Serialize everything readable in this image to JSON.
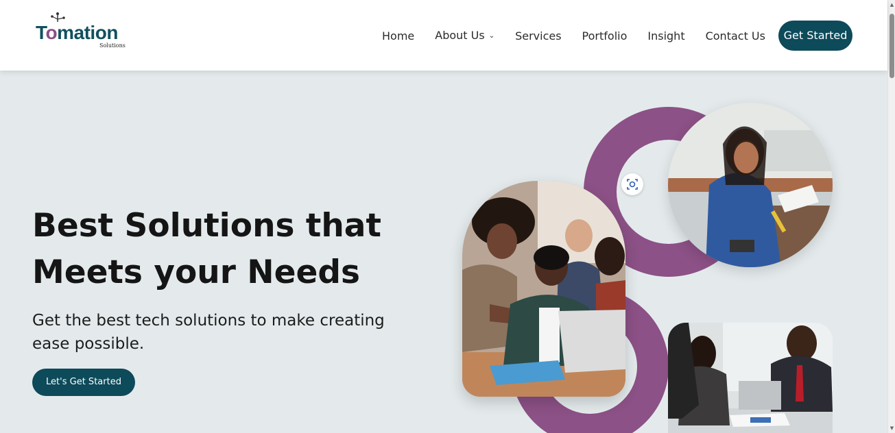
{
  "header": {
    "logo": {
      "word_start": "T",
      "word_o": "o",
      "word_end": "mation",
      "sub": "Solutions"
    },
    "nav": [
      {
        "label": "Home"
      },
      {
        "label": "About Us",
        "dropdown": true
      },
      {
        "label": "Services"
      },
      {
        "label": "Portfolio"
      },
      {
        "label": "Insight"
      },
      {
        "label": "Contact Us"
      }
    ],
    "cta_label": "Get Started"
  },
  "hero": {
    "title_line1": "Best Solutions that",
    "title_line2": "Meets your Needs",
    "subtitle": "Get the best tech solutions to make creating ease possible.",
    "button_label": "Let's Get Started"
  },
  "images": {
    "photo1": "woman-working-with-documents-photo",
    "photo2": "team-at-laptop-photo",
    "photo3": "business-meeting-photo",
    "lens_icon": "visual-search-icon"
  },
  "colors": {
    "brand_teal": "#0d4a5a",
    "brand_purple": "#8c5186",
    "background": "#e4eaec"
  }
}
